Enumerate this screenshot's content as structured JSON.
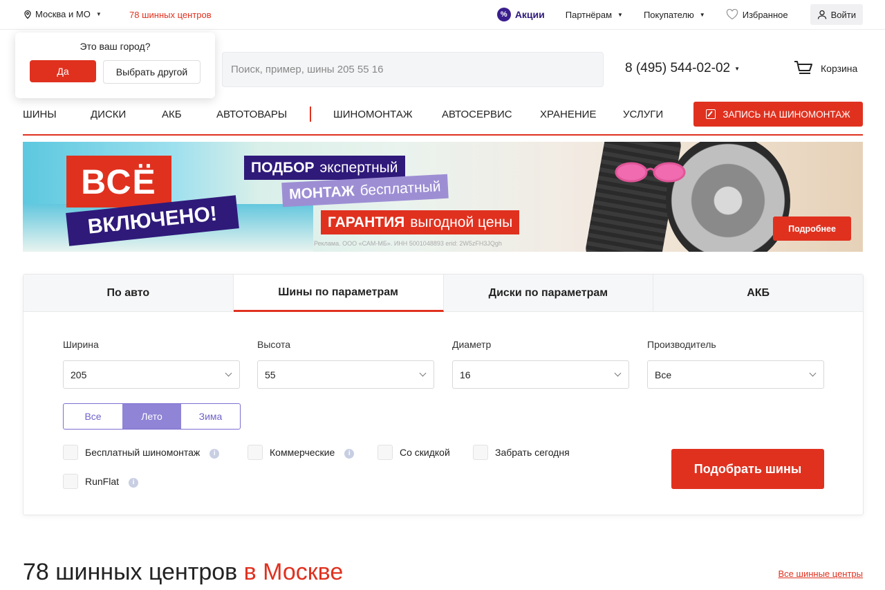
{
  "topbar": {
    "city": "Москва и МО",
    "centers_link": "78 шинных центров",
    "promo": "Акции",
    "partners": "Партнёрам",
    "buyer": "Покупателю",
    "favorites": "Избранное",
    "login": "Войти"
  },
  "city_popup": {
    "question": "Это ваш город?",
    "yes": "Да",
    "other": "Выбрать другой"
  },
  "header": {
    "search_placeholder": "Поиск, пример, шины 205 55 16",
    "phone": "8 (495) 544-02-02",
    "cart": "Корзина"
  },
  "nav": {
    "items": [
      "Шины",
      "Диски",
      "АКБ",
      "Автотовары",
      "Шиномонтаж",
      "Автосервис",
      "Хранение",
      "Услуги"
    ],
    "book": "Запись на шиномонтаж"
  },
  "banner": {
    "headline_1": "ВСЁ",
    "headline_2": "ВКЛЮЧЕНО!",
    "line1_bold": "ПОДБОР",
    "line1_rest": "экспертный",
    "line2_bold": "МОНТАЖ",
    "line2_rest": "бесплатный",
    "line3_bold": "ГАРАНТИЯ",
    "line3_rest": "выгодной цены",
    "legal": "Реклама. ООО «САМ-МБ». ИНН 5001048893 erid: 2W5zFH3JQgh",
    "more": "Подробнее"
  },
  "picker": {
    "tabs": [
      "По авто",
      "Шины по параметрам",
      "Диски по параметрам",
      "АКБ"
    ],
    "active_tab": 1,
    "fields": [
      {
        "label": "Ширина",
        "value": "205"
      },
      {
        "label": "Высота",
        "value": "55"
      },
      {
        "label": "Диаметр",
        "value": "16"
      },
      {
        "label": "Производитель",
        "value": "Все"
      }
    ],
    "seasons": [
      "Все",
      "Лето",
      "Зима"
    ],
    "active_season": 1,
    "checkboxes": [
      "Бесплатный шиномонтаж",
      "Коммерческие",
      "Со скидкой",
      "Забрать сегодня",
      "RunFlat"
    ],
    "submit": "Подобрать шины"
  },
  "centers": {
    "heading_main": "78 шинных центров",
    "heading_city": "в Москве",
    "all_link": "Все шинные центры"
  },
  "colors": {
    "brand_red": "#e0311f",
    "brand_purple": "#2f1a7a",
    "season_accent": "#8f84d6"
  }
}
